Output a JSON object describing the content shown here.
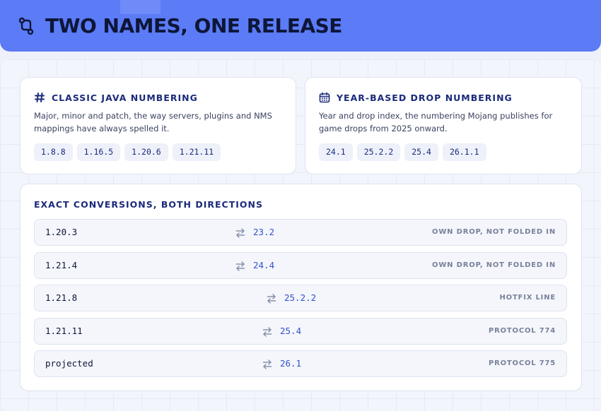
{
  "header": {
    "title": "TWO NAMES, ONE RELEASE",
    "icon": "branch-icon"
  },
  "classic": {
    "title": "CLASSIC JAVA NUMBERING",
    "icon": "hash-icon",
    "description": "Major, minor and patch, the way servers, plugins and NMS mappings have always spelled it.",
    "chips": [
      "1.8.8",
      "1.16.5",
      "1.20.6",
      "1.21.11"
    ]
  },
  "yearbased": {
    "title": "YEAR-BASED DROP NUMBERING",
    "icon": "calendar-icon",
    "description": "Year and drop index, the numbering Mojang publishes for game drops from 2025 onward.",
    "chips": [
      "24.1",
      "25.2.2",
      "25.4",
      "26.1.1"
    ]
  },
  "conversions": {
    "title": "EXACT CONVERSIONS, BOTH DIRECTIONS",
    "rows": [
      {
        "from": "1.20.3",
        "to": "23.2",
        "note": "OWN DROP, NOT FOLDED IN"
      },
      {
        "from": "1.21.4",
        "to": "24.4",
        "note": "OWN DROP, NOT FOLDED IN"
      },
      {
        "from": "1.21.8",
        "to": "25.2.2",
        "note": "HOTFIX LINE"
      },
      {
        "from": "1.21.11",
        "to": "25.4",
        "note": "PROTOCOL 774"
      },
      {
        "from": "projected",
        "to": "26.1",
        "note": "PROTOCOL 775"
      }
    ]
  },
  "colors": {
    "header": "#5b7cf6",
    "title": "#1b2a7a",
    "accent": "#3550c8"
  }
}
